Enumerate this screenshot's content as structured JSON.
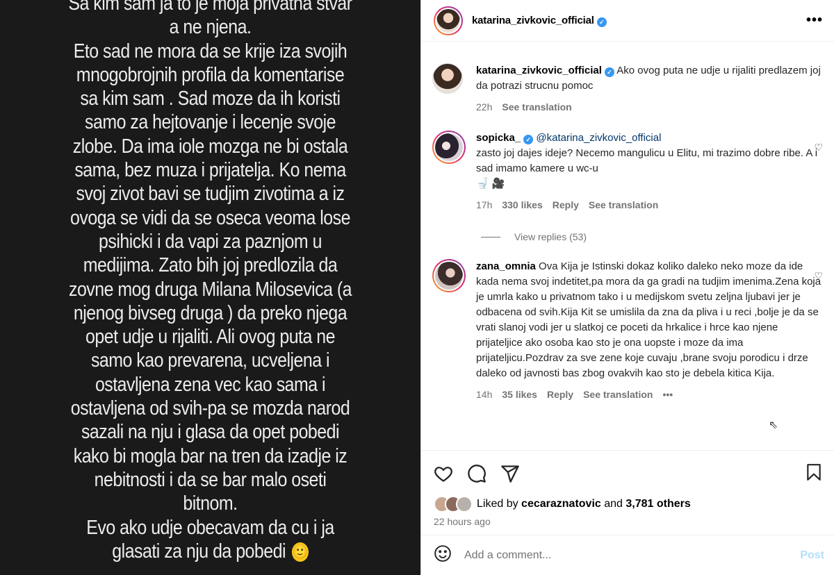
{
  "story": {
    "lines": [
      "Sa kim sam ja to je moja privatna stvar",
      "a ne njena.",
      "Eto sad ne mora da se krije iza svojih",
      "mnogobrojnih profila da komentarise",
      "sa kim sam .  Sad moze da ih koristi",
      "samo za hejtovanje i lecenje svoje",
      "zlobe. Da ima iole mozga ne bi ostala",
      "sama, bez muza i prijatelja. Ko nema",
      "svoj zivot bavi se tudjim zivotima a iz",
      "ovoga se vidi da se oseca veoma lose",
      "psihicki i da vapi za paznjom u",
      "medijima. Zato bih joj predlozila da",
      "zovne mog druga Milana Milosevica  (a",
      "njenog bivseg druga ) da preko njega",
      "opet udje u rijaliti. Ali ovog puta ne",
      "samo kao prevarena, ucveljena i",
      "ostavljena zena vec kao sama i",
      "ostavljena od svih-pa se mozda narod",
      "sazali  na nju i glasa da opet pobedi",
      "kako bi mogla  bar na tren da  izadje iz",
      "nebitnosti i da se bar malo oseti",
      "bitnom.",
      "Evo ako udje obecavam da cu i ja",
      "glasati za nju da pobedi"
    ],
    "emoji": "🙂"
  },
  "header": {
    "username": "katarina_zivkovic_official",
    "more": "•••"
  },
  "caption": {
    "username": "katarina_zivkovic_official",
    "text": "Ako ovog puta ne udje u rijaliti predlazem joj da potrazi strucnu pomoc",
    "time": "22h",
    "see_translation": "See translation"
  },
  "comments": [
    {
      "username": "sopicka_",
      "mention": "@katarina_zivkovic_official",
      "text": "zasto joj dajes ideje? Necemo mangulicu u Elitu, mi trazimo dobre ribe. A i sad imamo kamere u wc-u",
      "emojis": "🚽 🎥",
      "time": "17h",
      "likes": "330 likes",
      "reply": "Reply",
      "see_translation": "See translation",
      "view_replies": "View replies (53)"
    },
    {
      "username": "zana_omnia",
      "text": "Ova Kija je Istinski dokaz koliko daleko neko moze da ide kada nema svoj indetitet,pa mora da ga gradi na tudjim imenima.Zena koja je umrla kako u privatnom tako i u medijskom svetu zeljna ljubavi jer je odbacena od svih.Kija Kit se umislila da zna da pliva i u reci ,bolje je da se vrati slanoj vodi jer u slatkoj ce poceti da hrkalice i hrce kao njene prijateljice ako osoba kao sto je ona uopste i moze da ima prijateljicu.Pozdrav za sve zene koje cuvaju ,brane svoju porodicu i drze daleko od javnosti bas zbog ovakvih kao sto je debela kitica Kija.",
      "time": "14h",
      "likes": "35 likes",
      "reply": "Reply",
      "see_translation": "See translation",
      "more": "•••"
    }
  ],
  "likes": {
    "prefix": "Liked by",
    "user": "cecaraznatovic",
    "and": "and",
    "others": "3,781 others"
  },
  "time_ago": "22 hours ago",
  "add_comment": {
    "placeholder": "Add a comment...",
    "post": "Post"
  }
}
